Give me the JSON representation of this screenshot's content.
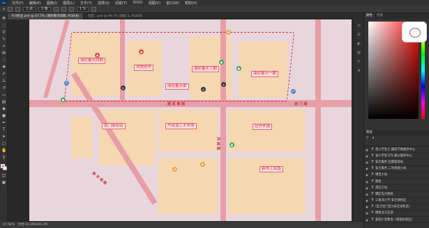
{
  "menu": [
    "文件(F)",
    "编辑(E)",
    "图像(I)",
    "图层(L)",
    "文字(Y)",
    "选择(S)",
    "滤镜(T)",
    "3D(D)",
    "视图(V)",
    "窗口(W)",
    "帮助(H)"
  ],
  "options": {
    "tool_label": "1 点",
    "size_label": "2 像",
    "zoom_value": "1 %"
  },
  "tabs": [
    "6.0商业.psd @ 47.7% (海伦春天四期, RGB/8)",
    "社区...psd @ 66.7% (图层 2, RGB/8)"
  ],
  "status": {
    "zoom": "47.68%",
    "doc_size": "文档:16.9M/266.2M"
  },
  "map": {
    "labels": {
      "haiLunSiQi": "海伦春天四期",
      "jinJiangDiJing": "滨悦府华",
      "haiLunErQi": "海伦春天二期",
      "haiLunYiQi": "海伦春天一期",
      "jiaDian": "海伦春天家",
      "nanKouZaiZhan": "南门接驳站",
      "ershou": "丹台道二手市场",
      "shishiHaoYuan": "壮丹丰源",
      "xinZhiGongYe": "新市工业园"
    },
    "roads": {
      "main": "惠 民 南 路",
      "left": "前 门 路",
      "diagonal": "新 华 南 路",
      "vertical": "风 城 路"
    }
  },
  "right_panel": {
    "tabs": [
      "颜色",
      "色板"
    ],
    "layers_tab": "图层",
    "layers": [
      "南小学生工 跟班学缘服务中心",
      "省小学生工作 跟以服务中心",
      "安全服务 区额保监站",
      "安全服务 二举部接小站",
      "爆坦小站",
      "图层",
      "黑区工坊",
      "爆区电力图纸",
      "三角海小学 安全接机区",
      "(区元拉门区)(安全接机区)",
      "爆板总工区部",
      "安国小里集电..(保密机构区)"
    ]
  },
  "colors": {
    "fg": "#e6a2a8",
    "bg": "#ffffff",
    "accent": "#d3303f",
    "block": "#f5d7b2",
    "road": "#e89ea6"
  }
}
